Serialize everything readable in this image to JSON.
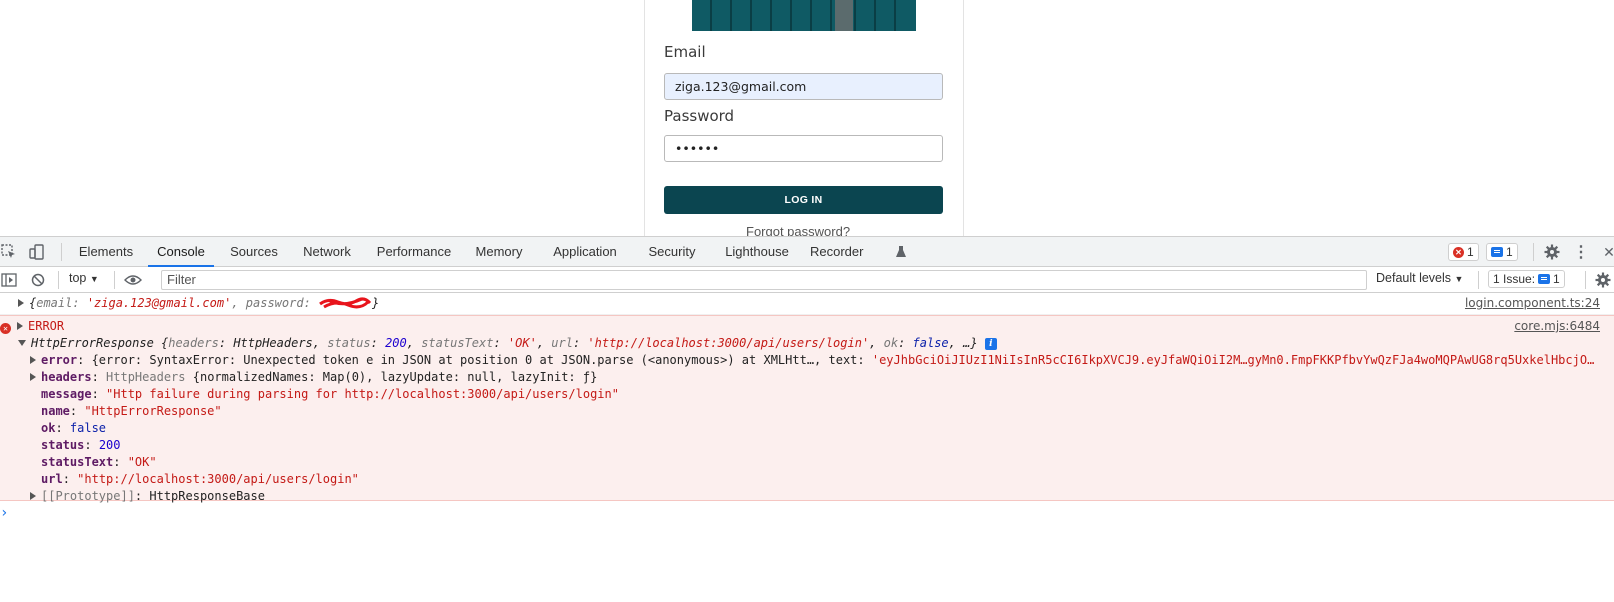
{
  "login": {
    "email_label": "Email",
    "email_value": "ziga.123@gmail.com",
    "password_label": "Password",
    "password_value": "••••••",
    "login_button": "LOG IN",
    "forgot_password": "Forgot password?"
  },
  "devtools": {
    "tabs": [
      "Elements",
      "Console",
      "Sources",
      "Network",
      "Performance",
      "Memory",
      "Application",
      "Security",
      "Lighthouse",
      "Recorder"
    ],
    "active_tab": "Console",
    "error_count": "1",
    "message_count": "1",
    "context": "top",
    "filter_placeholder": "Filter",
    "levels": "Default levels",
    "issues_label": "1 Issue:",
    "issues_count": "1"
  },
  "console": {
    "log": {
      "open": "{",
      "email_key": "email",
      "email_val": "'ziga.123@gmail.com'",
      "password_key": "password",
      "close": "}",
      "source": "login.component.ts:24"
    },
    "error": {
      "label": "ERROR",
      "source": "core.mjs:6484",
      "summary_class": "HttpErrorResponse",
      "summary_headers_key": "headers",
      "summary_headers_val": "HttpHeaders",
      "summary_status_key": "status",
      "summary_status_val": "200",
      "summary_statustext_key": "statusText",
      "summary_statustext_val": "'OK'",
      "summary_url_key": "url",
      "summary_url_val": "'http://localhost:3000/api/users/login'",
      "summary_ok_key": "ok",
      "summary_ok_val": "false",
      "summary_more": "…}",
      "props": {
        "error_key": "error",
        "error_val": "{error: SyntaxError: Unexpected token e in JSON at position 0 at JSON.parse (<anonymous>) at XMLHtt…, text: ",
        "error_text": "'eyJhbGciOiJIUzI1NiIsInR5cCI6IkpXVCJ9.eyJfaWQiOiI2M…gyMn0.FmpFKKPfbvYwQzFJa4woMQPAwUG8rq5UxkelHbcjO…",
        "headers_key": "headers",
        "headers_cls": "HttpHeaders",
        "headers_val": "{normalizedNames: Map(0), lazyUpdate: null, lazyInit: ƒ}",
        "message_key": "message",
        "message_val": "\"Http failure during parsing for http://localhost:3000/api/users/login\"",
        "name_key": "name",
        "name_val": "\"HttpErrorResponse\"",
        "ok_key": "ok",
        "ok_val": "false",
        "status_key": "status",
        "status_val": "200",
        "statustext_key": "statusText",
        "statustext_val": "\"OK\"",
        "url_key": "url",
        "url_val": "\"http://localhost:3000/api/users/login\"",
        "proto_key": "[[Prototype]]",
        "proto_val": "HttpResponseBase"
      }
    },
    "prompt": "›"
  }
}
